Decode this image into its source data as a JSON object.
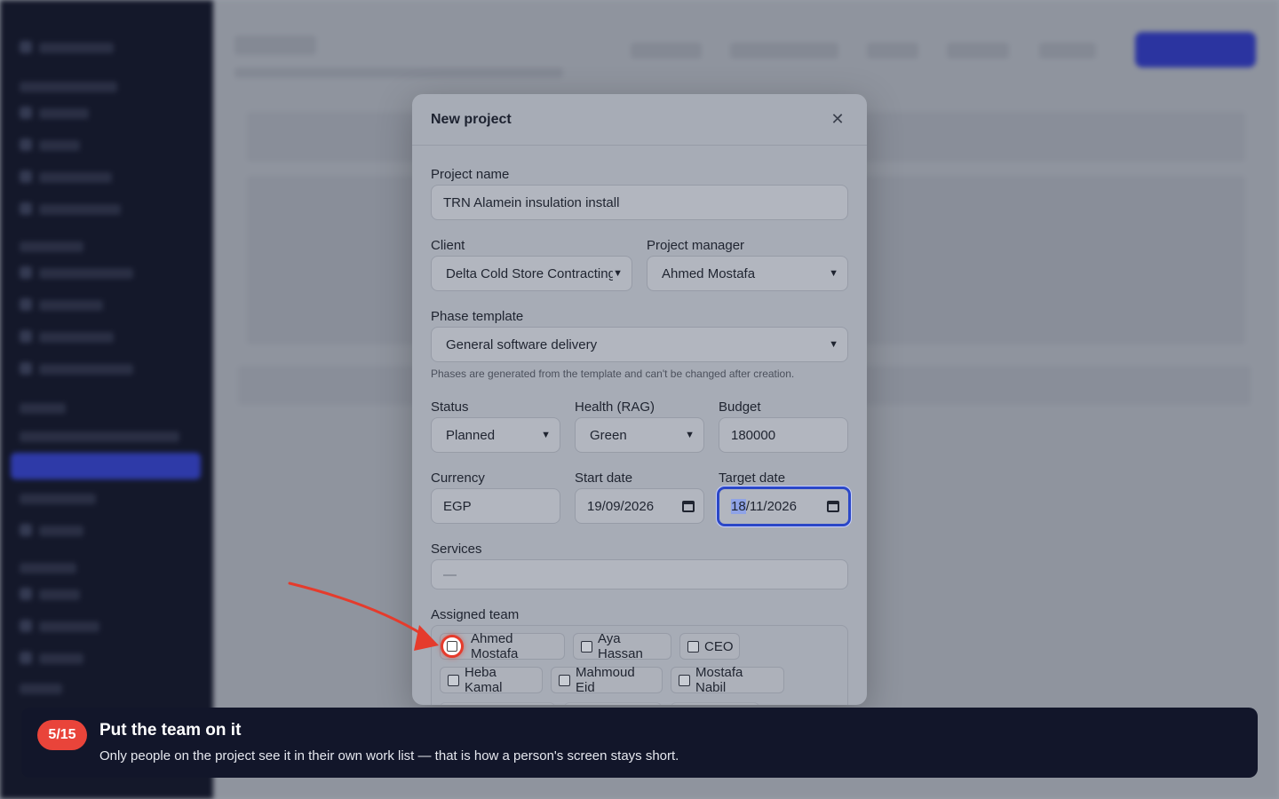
{
  "modal": {
    "title": "New project",
    "close_icon": "close-icon",
    "project_name": {
      "label": "Project name",
      "value": "TRN Alamein insulation install"
    },
    "client": {
      "label": "Client",
      "value": "Delta Cold Store Contracting"
    },
    "project_manager": {
      "label": "Project manager",
      "value": "Ahmed Mostafa"
    },
    "phase_template": {
      "label": "Phase template",
      "value": "General software delivery",
      "hint": "Phases are generated from the template and can't be changed after creation."
    },
    "status": {
      "label": "Status",
      "value": "Planned"
    },
    "health": {
      "label": "Health (RAG)",
      "value": "Green"
    },
    "budget": {
      "label": "Budget",
      "value": "180000"
    },
    "currency": {
      "label": "Currency",
      "value": "EGP"
    },
    "start_date": {
      "label": "Start date",
      "value": "19/09/2026"
    },
    "target_date": {
      "label": "Target date",
      "value_selected": "18",
      "value_rest": "/11/2026"
    },
    "services": {
      "label": "Services",
      "value": "—"
    },
    "assigned_team": {
      "label": "Assigned team",
      "members": [
        "Ahmed Mostafa",
        "Aya Hassan",
        "CEO",
        "Heba Kamal",
        "Mahmoud Eid",
        "Mostafa Nabil"
      ]
    }
  },
  "tour": {
    "step": "5/15",
    "title": "Put the team on it",
    "text": "Only people on the project see it in their own work list — that is how a person's screen stays short."
  },
  "colors": {
    "accent": "#2b47c7",
    "tour_badge": "#e9443a",
    "arrow": "#e53b2c",
    "toast_bg": "#12162a"
  }
}
